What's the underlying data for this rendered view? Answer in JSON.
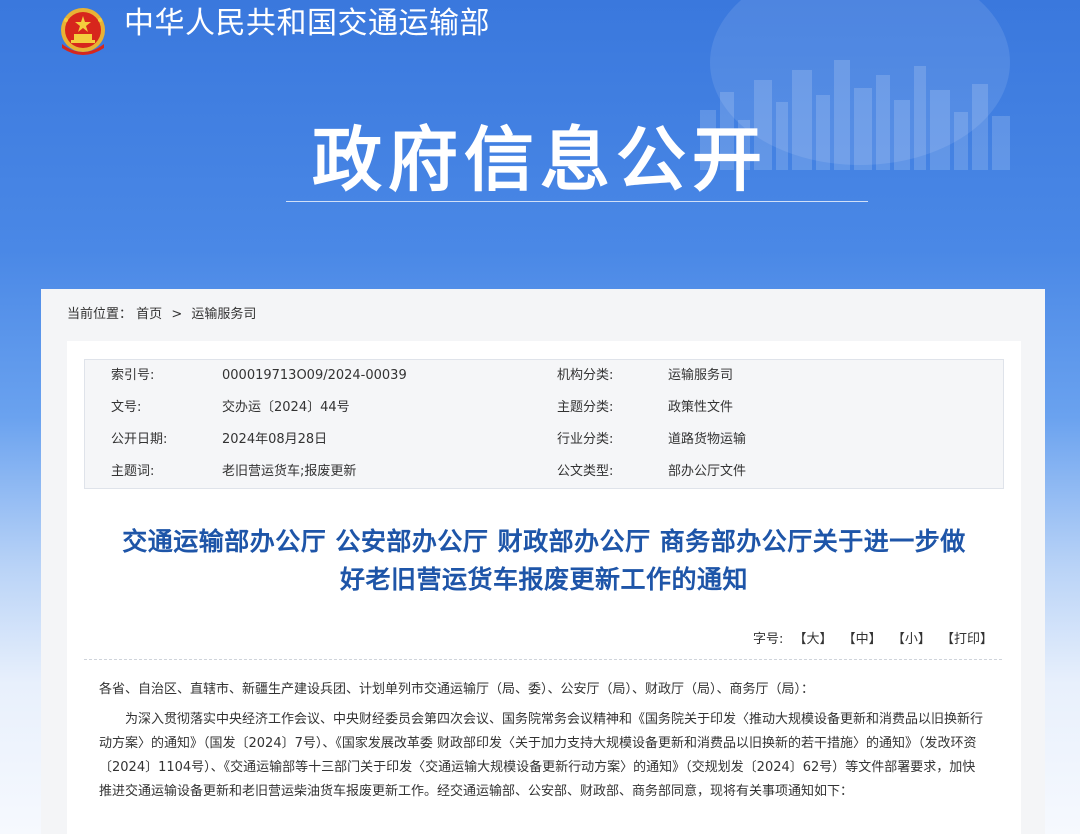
{
  "header": {
    "ministry_name": "中华人民共和国交通运输部",
    "banner_title": "政府信息公开"
  },
  "breadcrumb": {
    "label": "当前位置：",
    "items": [
      "首页",
      "运输服务司"
    ],
    "separator": ">"
  },
  "meta": {
    "index_no": {
      "label": "索引号:",
      "value": "000019713O09/2024-00039"
    },
    "doc_no": {
      "label": "文号:",
      "value": "交办运〔2024〕44号"
    },
    "publish_date": {
      "label": "公开日期:",
      "value": "2024年08月28日"
    },
    "keywords": {
      "label": "主题词:",
      "value": "老旧营运货车;报废更新"
    },
    "org_category": {
      "label": "机构分类:",
      "value": "运输服务司"
    },
    "topic_category": {
      "label": "主题分类:",
      "value": "政策性文件"
    },
    "industry_category": {
      "label": "行业分类:",
      "value": "道路货物运输"
    },
    "doc_type": {
      "label": "公文类型:",
      "value": "部办公厅文件"
    }
  },
  "document": {
    "title_line1": "交通运输部办公厅 公安部办公厅 财政部办公厅 商务部办公厅关于进一步做",
    "title_line2": "好老旧营运货车报废更新工作的通知",
    "font_size_label": "字号:",
    "font_large": "【大】",
    "font_medium": "【中】",
    "font_small": "【小】",
    "print": "【打印】",
    "salutation": "各省、自治区、直辖市、新疆生产建设兵团、计划单列市交通运输厅（局、委）、公安厅（局）、财政厅（局）、商务厅（局）：",
    "paragraph1": "为深入贯彻落实中央经济工作会议、中央财经委员会第四次会议、国务院常务会议精神和《国务院关于印发〈推动大规模设备更新和消费品以旧换新行动方案〉的通知》（国发〔2024〕7号）、《国家发展改革委 财政部印发〈关于加力支持大规模设备更新和消费品以旧换新的若干措施〉的通知》（发改环资〔2024〕1104号）、《交通运输部等十三部门关于印发〈交通运输大规模设备更新行动方案〉的通知》（交规划发〔2024〕62号）等文件部署要求，加快推进交通运输设备更新和老旧营运柴油货车报废更新工作。经交通运输部、公安部、财政部、商务部同意，现将有关事项通知如下："
  },
  "colors": {
    "banner_blue": "#3a78dd",
    "title_blue": "#1e55a8"
  }
}
